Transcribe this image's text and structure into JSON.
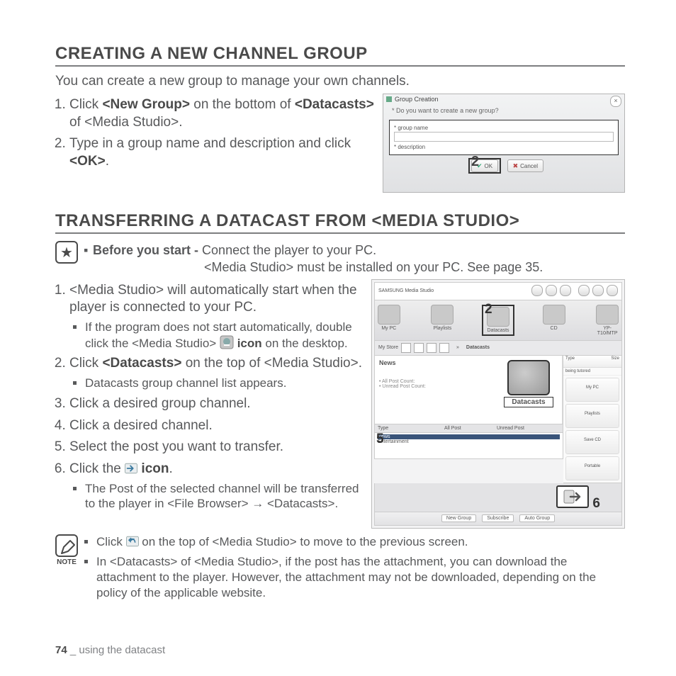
{
  "section1": {
    "title": "CREATING A NEW CHANNEL GROUP",
    "intro": "You can create a new group to manage your own channels.",
    "step1_a": "Click ",
    "step1_b": "<New Group>",
    "step1_c": " on the bottom of ",
    "step1_d": "<Datacasts>",
    "step1_e": " of <Media Studio>.",
    "step2_a": "Type in a group name and description and click ",
    "step2_b": "<OK>",
    "step2_c": ".",
    "dialog": {
      "title": "Group Creation",
      "question": "Do you want to create a new group?",
      "field1": "group name",
      "field2": "description",
      "ok": "OK",
      "cancel": "Cancel",
      "callout": "2"
    }
  },
  "section2": {
    "title": "TRANSFERRING A DATACAST FROM <MEDIA STUDIO>",
    "bys_label": "Before you start - ",
    "bys_line1": "Connect the player to your PC.",
    "bys_line2": "<Media Studio> must be installed on your PC. See page 35.",
    "step1": "<Media Studio> will automatically start when the player is connected to your PC.",
    "step1_sub_a": "If the program does not start automatically, double click the <Media Studio> ",
    "step1_sub_b": " icon",
    "step1_sub_c": " on the desktop.",
    "step2_a": "Click ",
    "step2_b": "<Datacasts>",
    "step2_c": " on the top of <Media Studio>.",
    "step2_sub": "Datacasts group channel list appears.",
    "step3": "Click a desired group channel.",
    "step4": "Click a desired channel.",
    "step5": "Select the post you want to transfer.",
    "step6_a": "Click the ",
    "step6_b": " icon",
    "step6_c": ".",
    "step6_sub": "The Post of the selected channel will be transferred to the player in <File Browser> → <Datacasts>.",
    "fig": {
      "brand": "SAMSUNG Media Studio",
      "icons": {
        "mypc": "My PC",
        "playlists": "Playlists",
        "datacasts": "Datacasts",
        "cd": "CD",
        "device": "YP-T10/MTP"
      },
      "tab": "Datacasts",
      "news": "News",
      "allpost": "All Post Count:",
      "unreadpost": "Unread Post Count:",
      "dc_label": "Datacasts",
      "right_tabs": {
        "r1": "My PC",
        "r2": "Playlists",
        "r3": "Save CD",
        "r4": "Portable"
      },
      "right_head_type": "Type",
      "right_head_size": "Size",
      "right_file": "being tutored",
      "grid_head": {
        "type": "Type",
        "allcat": "All Post",
        "unread": "Unread Post"
      },
      "grid_rows": [
        {
          "a": "News",
          "b": " ",
          "c": " "
        },
        {
          "a": "Entertainment",
          "b": " ",
          "c": " "
        }
      ],
      "bottom": {
        "b1": "New Group",
        "b2": "Subscribe",
        "b3": "Auto Group"
      },
      "callout2": "2",
      "callout5": "5",
      "callout6": "6"
    },
    "note_label": "NOTE",
    "note1_a": "Click  ",
    "note1_b": "  on the top of <Media Studio> to move to the previous screen.",
    "note2": "In <Datacasts> of <Media Studio>, if the post has the attachment, you can download the attachment to the player. However, the attachment may not be downloaded, depending on the policy of the applicable website."
  },
  "footer": {
    "page": "74",
    "sep": " _ ",
    "text": "using the datacast"
  }
}
